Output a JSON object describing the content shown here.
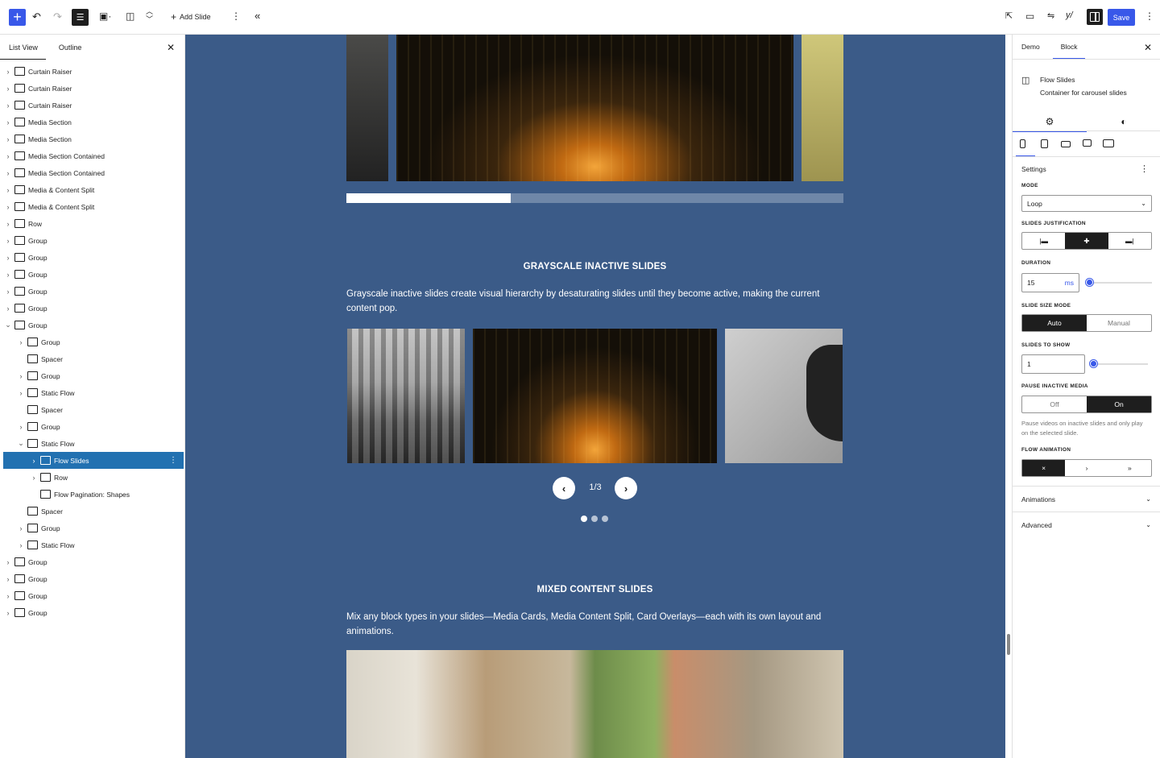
{
  "toolbar": {
    "add_slide_label": "Add Slide",
    "save_label": "Save",
    "inserter": "+",
    "icons": [
      "plus-icon",
      "undo-icon",
      "redo-icon",
      "list-view-icon",
      "block-icon",
      "move-icon",
      "options-icon",
      "collapse-icon",
      "external-icon",
      "preview-icon",
      "settings-icon",
      "yoast-icon",
      "sidebar-icon",
      "more-icon"
    ]
  },
  "left_panel": {
    "tabs": [
      "List View",
      "Outline"
    ],
    "items": [
      {
        "label": "Curtain Raiser",
        "depth": 0,
        "chev": "›"
      },
      {
        "label": "Curtain Raiser",
        "depth": 0,
        "chev": "›"
      },
      {
        "label": "Curtain Raiser",
        "depth": 0,
        "chev": "›"
      },
      {
        "label": "Media Section",
        "depth": 0,
        "chev": "›"
      },
      {
        "label": "Media Section",
        "depth": 0,
        "chev": "›"
      },
      {
        "label": "Media Section Contained",
        "depth": 0,
        "chev": "›"
      },
      {
        "label": "Media Section Contained",
        "depth": 0,
        "chev": "›"
      },
      {
        "label": "Media & Content Split",
        "depth": 0,
        "chev": "›"
      },
      {
        "label": "Media & Content Split",
        "depth": 0,
        "chev": "›"
      },
      {
        "label": "Row",
        "depth": 0,
        "chev": "›"
      },
      {
        "label": "Group",
        "depth": 0,
        "chev": "›"
      },
      {
        "label": "Group",
        "depth": 0,
        "chev": "›"
      },
      {
        "label": "Group",
        "depth": 0,
        "chev": "›"
      },
      {
        "label": "Group",
        "depth": 0,
        "chev": "›"
      },
      {
        "label": "Group",
        "depth": 0,
        "chev": "›"
      },
      {
        "label": "Group",
        "depth": 0,
        "chev": "⌄"
      },
      {
        "label": "Group",
        "depth": 1,
        "chev": "›"
      },
      {
        "label": "Spacer",
        "depth": 1,
        "chev": ""
      },
      {
        "label": "Group",
        "depth": 1,
        "chev": "›"
      },
      {
        "label": "Static Flow",
        "depth": 1,
        "chev": "›"
      },
      {
        "label": "Spacer",
        "depth": 1,
        "chev": ""
      },
      {
        "label": "Group",
        "depth": 1,
        "chev": "›"
      },
      {
        "label": "Static Flow",
        "depth": 1,
        "chev": "⌄"
      },
      {
        "label": "Flow Slides",
        "depth": 2,
        "chev": "›",
        "selected": true
      },
      {
        "label": "Row",
        "depth": 2,
        "chev": "›"
      },
      {
        "label": "Flow Pagination: Shapes",
        "depth": 2,
        "chev": ""
      },
      {
        "label": "Spacer",
        "depth": 1,
        "chev": ""
      },
      {
        "label": "Group",
        "depth": 1,
        "chev": "›"
      },
      {
        "label": "Static Flow",
        "depth": 1,
        "chev": "›"
      },
      {
        "label": "Group",
        "depth": 0,
        "chev": "›"
      },
      {
        "label": "Group",
        "depth": 0,
        "chev": "›"
      },
      {
        "label": "Group",
        "depth": 0,
        "chev": "›"
      },
      {
        "label": "Group",
        "depth": 0,
        "chev": "›"
      }
    ]
  },
  "canvas": {
    "section1_heading": "GRAYSCALE INACTIVE SLIDES",
    "section1_text": "Grayscale inactive slides create visual hierarchy by desaturating slides until they become active, making the current content pop.",
    "counter": "1/3",
    "progress": 0.33,
    "section2_heading": "MIXED CONTENT SLIDES",
    "section2_text": "Mix any block types in your slides—Media Cards, Media Content Split, Card Overlays—each with its own layout and animations."
  },
  "right_panel": {
    "tabs": [
      "Demo",
      "Block"
    ],
    "block_title": "Flow Slides",
    "block_desc": "Container for carousel slides",
    "settings_title": "Settings",
    "mode_label": "MODE",
    "mode_value": "Loop",
    "justification_label": "SLIDES JUSTIFICATION",
    "duration_label": "DURATION",
    "duration_value": "15",
    "duration_unit": "ms",
    "slide_size_label": "SLIDE SIZE MODE",
    "slide_size_auto": "Auto",
    "slide_size_manual": "Manual",
    "slides_to_show_label": "SLIDES TO SHOW",
    "slides_to_show_value": "1",
    "pause_label": "PAUSE INACTIVE MEDIA",
    "pause_off": "Off",
    "pause_on": "On",
    "pause_help": "Pause videos on inactive slides and only play on the selected slide.",
    "flow_anim_label": "FLOW ANIMATION",
    "flow_anim_options": [
      "×",
      "›",
      "»"
    ],
    "animations_label": "Animations",
    "advanced_label": "Advanced"
  }
}
